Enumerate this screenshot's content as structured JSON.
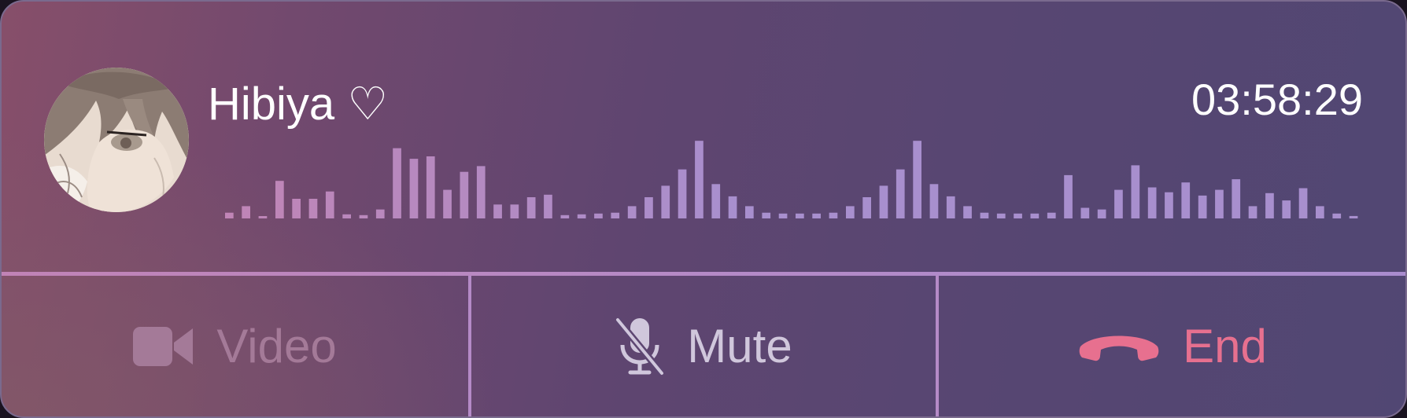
{
  "caller": {
    "name": "Hibiya ♡",
    "avatar": "anime-character-avatar"
  },
  "call": {
    "duration": "03:58:29"
  },
  "waveform": {
    "levels": [
      0.07,
      0.15,
      0.02,
      0.46,
      0.24,
      0.24,
      0.33,
      0.05,
      0.04,
      0.11,
      0.86,
      0.73,
      0.76,
      0.35,
      0.57,
      0.64,
      0.17,
      0.17,
      0.26,
      0.29,
      0.04,
      0.05,
      0.06,
      0.07,
      0.15,
      0.26,
      0.4,
      0.6,
      0.95,
      0.42,
      0.27,
      0.15,
      0.07,
      0.06,
      0.06,
      0.06,
      0.07,
      0.15,
      0.26,
      0.4,
      0.6,
      0.95,
      0.42,
      0.27,
      0.15,
      0.07,
      0.06,
      0.06,
      0.06,
      0.07,
      0.53,
      0.13,
      0.11,
      0.35,
      0.65,
      0.38,
      0.32,
      0.44,
      0.28,
      0.35,
      0.48,
      0.15,
      0.31,
      0.22,
      0.37,
      0.15,
      0.06,
      0.03
    ],
    "color": "#a88fce"
  },
  "actions": {
    "video": {
      "label": "Video",
      "icon": "video-camera-icon",
      "color": "#a47a98"
    },
    "mute": {
      "label": "Mute",
      "icon": "microphone-muted-icon",
      "color": "#d0c7dc"
    },
    "end": {
      "label": "End",
      "icon": "hang-up-phone-icon",
      "color": "#e7708f"
    }
  }
}
